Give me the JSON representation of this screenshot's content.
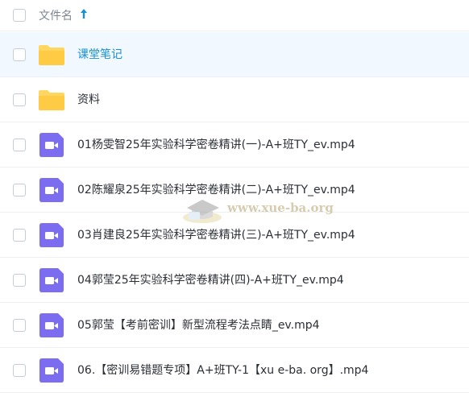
{
  "header": {
    "column_label": "文件名",
    "sort_icon": "arrow-up-icon",
    "sort_direction": "ascending"
  },
  "files": [
    {
      "name": "课堂笔记",
      "type": "folder",
      "icon": "folder-icon",
      "selected": true
    },
    {
      "name": "资料",
      "type": "folder",
      "icon": "folder-icon",
      "selected": false
    },
    {
      "name": "01杨雯智25年实验科学密卷精讲(一)-A+班TY_ev.mp4",
      "type": "video",
      "icon": "video-file-icon",
      "selected": false
    },
    {
      "name": "02陈耀泉25年实验科学密卷精讲(二)-A+班TY_ev.mp4",
      "type": "video",
      "icon": "video-file-icon",
      "selected": false
    },
    {
      "name": "03肖建良25年实验科学密卷精讲(三)-A+班TY_ev.mp4",
      "type": "video",
      "icon": "video-file-icon",
      "selected": false
    },
    {
      "name": "04郭莹25年实验科学密卷精讲(四)-A+班TY_ev.mp4",
      "type": "video",
      "icon": "video-file-icon",
      "selected": false
    },
    {
      "name": "05郭莹【考前密训】新型流程考法点睛_ev.mp4",
      "type": "video",
      "icon": "video-file-icon",
      "selected": false
    },
    {
      "name": "06.【密训易错题专项】A+班TY-1【xu e-ba. org】.mp4",
      "type": "video",
      "icon": "video-file-icon",
      "selected": false
    }
  ],
  "watermark": {
    "text": "www.xue-ba.org"
  },
  "colors": {
    "folder": "#ffd660",
    "video_icon": "#7b6cf0",
    "link": "#1890d6",
    "selected_row": "#f2f8ff"
  }
}
